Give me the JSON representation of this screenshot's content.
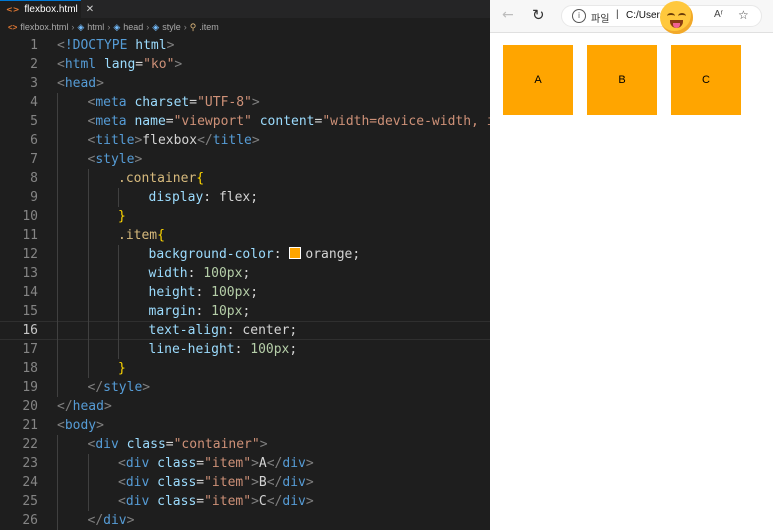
{
  "editor": {
    "tab": {
      "label": "flexbox.html",
      "icon": "html-file-icon",
      "close": "✕"
    },
    "breadcrumb": [
      "flexbox.html",
      "html",
      "head",
      "style",
      ".item"
    ],
    "lines": [
      {
        "n": "1",
        "indent": 0,
        "toks": [
          [
            "br",
            "<"
          ],
          [
            "tag",
            "!DOCTYPE"
          ],
          [
            "text",
            " "
          ],
          [
            "attr",
            "html"
          ],
          [
            "br",
            ">"
          ]
        ]
      },
      {
        "n": "2",
        "indent": 0,
        "toks": [
          [
            "br",
            "<"
          ],
          [
            "tag",
            "html"
          ],
          [
            "text",
            " "
          ],
          [
            "attr",
            "lang"
          ],
          [
            "text",
            "="
          ],
          [
            "str",
            "\"ko\""
          ],
          [
            "br",
            ">"
          ]
        ]
      },
      {
        "n": "3",
        "indent": 0,
        "toks": [
          [
            "br",
            "<"
          ],
          [
            "tag",
            "head"
          ],
          [
            "br",
            ">"
          ]
        ]
      },
      {
        "n": "4",
        "indent": 1,
        "toks": [
          [
            "br",
            "<"
          ],
          [
            "tag",
            "meta"
          ],
          [
            "text",
            " "
          ],
          [
            "attr",
            "charset"
          ],
          [
            "text",
            "="
          ],
          [
            "str",
            "\"UTF-8\""
          ],
          [
            "br",
            ">"
          ]
        ]
      },
      {
        "n": "5",
        "indent": 1,
        "toks": [
          [
            "br",
            "<"
          ],
          [
            "tag",
            "meta"
          ],
          [
            "text",
            " "
          ],
          [
            "attr",
            "name"
          ],
          [
            "text",
            "="
          ],
          [
            "str",
            "\"viewport\""
          ],
          [
            "text",
            " "
          ],
          [
            "attr",
            "content"
          ],
          [
            "text",
            "="
          ],
          [
            "str",
            "\"width=device-width, i"
          ]
        ]
      },
      {
        "n": "6",
        "indent": 1,
        "toks": [
          [
            "br",
            "<"
          ],
          [
            "tag",
            "title"
          ],
          [
            "br",
            ">"
          ],
          [
            "text",
            "flexbox"
          ],
          [
            "br",
            "</"
          ],
          [
            "tag",
            "title"
          ],
          [
            "br",
            ">"
          ]
        ]
      },
      {
        "n": "7",
        "indent": 1,
        "toks": [
          [
            "br",
            "<"
          ],
          [
            "tag",
            "style"
          ],
          [
            "br",
            ">"
          ]
        ]
      },
      {
        "n": "8",
        "indent": 2,
        "toks": [
          [
            "sel",
            ".container"
          ],
          [
            "brace",
            "{"
          ]
        ]
      },
      {
        "n": "9",
        "indent": 3,
        "toks": [
          [
            "attr",
            "display"
          ],
          [
            "text",
            ": flex;"
          ]
        ]
      },
      {
        "n": "10",
        "indent": 2,
        "toks": [
          [
            "brace",
            "}"
          ]
        ]
      },
      {
        "n": "11",
        "indent": 2,
        "toks": [
          [
            "sel",
            ".item"
          ],
          [
            "brace",
            "{"
          ]
        ]
      },
      {
        "n": "12",
        "indent": 3,
        "toks": [
          [
            "attr",
            "background-color"
          ],
          [
            "text",
            ": "
          ],
          [
            "swatch",
            ""
          ],
          [
            "text",
            "orange;"
          ]
        ]
      },
      {
        "n": "13",
        "indent": 3,
        "toks": [
          [
            "attr",
            "width"
          ],
          [
            "text",
            ": "
          ],
          [
            "num",
            "100px"
          ],
          [
            "text",
            ";"
          ]
        ]
      },
      {
        "n": "14",
        "indent": 3,
        "toks": [
          [
            "attr",
            "height"
          ],
          [
            "text",
            ": "
          ],
          [
            "num",
            "100px"
          ],
          [
            "text",
            ";"
          ]
        ]
      },
      {
        "n": "15",
        "indent": 3,
        "toks": [
          [
            "attr",
            "margin"
          ],
          [
            "text",
            ": "
          ],
          [
            "num",
            "10px"
          ],
          [
            "text",
            ";"
          ]
        ]
      },
      {
        "n": "16",
        "indent": 3,
        "active": true,
        "toks": [
          [
            "attr",
            "text-align"
          ],
          [
            "text",
            ": center;"
          ]
        ]
      },
      {
        "n": "17",
        "indent": 3,
        "toks": [
          [
            "attr",
            "line-height"
          ],
          [
            "text",
            ": "
          ],
          [
            "num",
            "100px"
          ],
          [
            "text",
            ";"
          ]
        ]
      },
      {
        "n": "18",
        "indent": 2,
        "toks": [
          [
            "brace",
            "}"
          ]
        ]
      },
      {
        "n": "19",
        "indent": 1,
        "toks": [
          [
            "br",
            "</"
          ],
          [
            "tag",
            "style"
          ],
          [
            "br",
            ">"
          ]
        ]
      },
      {
        "n": "20",
        "indent": 0,
        "toks": [
          [
            "br",
            "</"
          ],
          [
            "tag",
            "head"
          ],
          [
            "br",
            ">"
          ]
        ]
      },
      {
        "n": "21",
        "indent": 0,
        "toks": [
          [
            "br",
            "<"
          ],
          [
            "tag",
            "body"
          ],
          [
            "br",
            ">"
          ]
        ]
      },
      {
        "n": "22",
        "indent": 1,
        "toks": [
          [
            "br",
            "<"
          ],
          [
            "tag",
            "div"
          ],
          [
            "text",
            " "
          ],
          [
            "attr",
            "class"
          ],
          [
            "text",
            "="
          ],
          [
            "str",
            "\"container\""
          ],
          [
            "br",
            ">"
          ]
        ]
      },
      {
        "n": "23",
        "indent": 2,
        "toks": [
          [
            "br",
            "<"
          ],
          [
            "tag",
            "div"
          ],
          [
            "text",
            " "
          ],
          [
            "attr",
            "class"
          ],
          [
            "text",
            "="
          ],
          [
            "str",
            "\"item\""
          ],
          [
            "br",
            ">"
          ],
          [
            "text",
            "A"
          ],
          [
            "br",
            "</"
          ],
          [
            "tag",
            "div"
          ],
          [
            "br",
            ">"
          ]
        ]
      },
      {
        "n": "24",
        "indent": 2,
        "toks": [
          [
            "br",
            "<"
          ],
          [
            "tag",
            "div"
          ],
          [
            "text",
            " "
          ],
          [
            "attr",
            "class"
          ],
          [
            "text",
            "="
          ],
          [
            "str",
            "\"item\""
          ],
          [
            "br",
            ">"
          ],
          [
            "text",
            "B"
          ],
          [
            "br",
            "</"
          ],
          [
            "tag",
            "div"
          ],
          [
            "br",
            ">"
          ]
        ]
      },
      {
        "n": "25",
        "indent": 2,
        "toks": [
          [
            "br",
            "<"
          ],
          [
            "tag",
            "div"
          ],
          [
            "text",
            " "
          ],
          [
            "attr",
            "class"
          ],
          [
            "text",
            "="
          ],
          [
            "str",
            "\"item\""
          ],
          [
            "br",
            ">"
          ],
          [
            "text",
            "C"
          ],
          [
            "br",
            "</"
          ],
          [
            "tag",
            "div"
          ],
          [
            "br",
            ">"
          ]
        ]
      },
      {
        "n": "26",
        "indent": 1,
        "toks": [
          [
            "br",
            "</"
          ],
          [
            "tag",
            "div"
          ],
          [
            "br",
            ">"
          ]
        ]
      }
    ]
  },
  "browser": {
    "back_icon": "back-arrow-icon",
    "refresh_icon": "refresh-icon",
    "info_icon": "info-icon",
    "protocol_label": "파일",
    "url": "C:/Users",
    "read_aloud_icon": "read-aloud-icon",
    "read_aloud_label": "Aʳ",
    "favorite_icon": "add-favorite-icon",
    "items": [
      "A",
      "B",
      "C"
    ],
    "item_color": "#ffa500"
  }
}
